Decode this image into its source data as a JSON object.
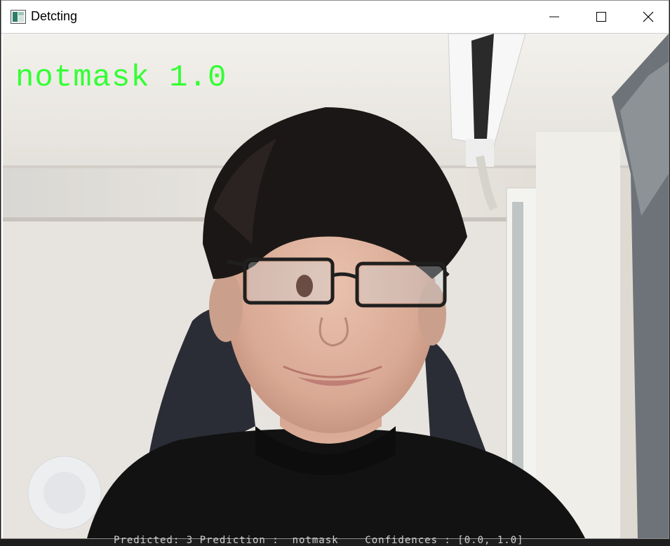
{
  "window": {
    "title": "Detcting",
    "controls": {
      "minimize": "minimize-icon",
      "maximize": "maximize-icon",
      "close": "close-icon"
    }
  },
  "camera": {
    "overlay_label": "notmask 1.0",
    "overlay_color": "#33ff33"
  },
  "console": {
    "line": "Predicted: 3 Prediction :  notmask    Confidences : [0.0, 1.0]"
  }
}
